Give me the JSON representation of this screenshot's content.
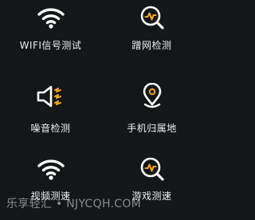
{
  "tools": [
    {
      "label": "WIFI信号测试",
      "icon": "wifi-icon"
    },
    {
      "label": "蹭网检测",
      "icon": "pulse-search-icon"
    },
    {
      "label": "噪音检测",
      "icon": "speaker-noise-icon"
    },
    {
      "label": "手机归属地",
      "icon": "location-pin-icon"
    },
    {
      "label": "视频测速",
      "icon": "wifi-icon"
    },
    {
      "label": "游戏测速",
      "icon": "pulse-search-icon"
    }
  ],
  "watermark": "乐享轻汇 • NJYCQH.COM",
  "colors": {
    "background": "#141718",
    "icon": "#ffffff",
    "accent": "#f5a623"
  }
}
